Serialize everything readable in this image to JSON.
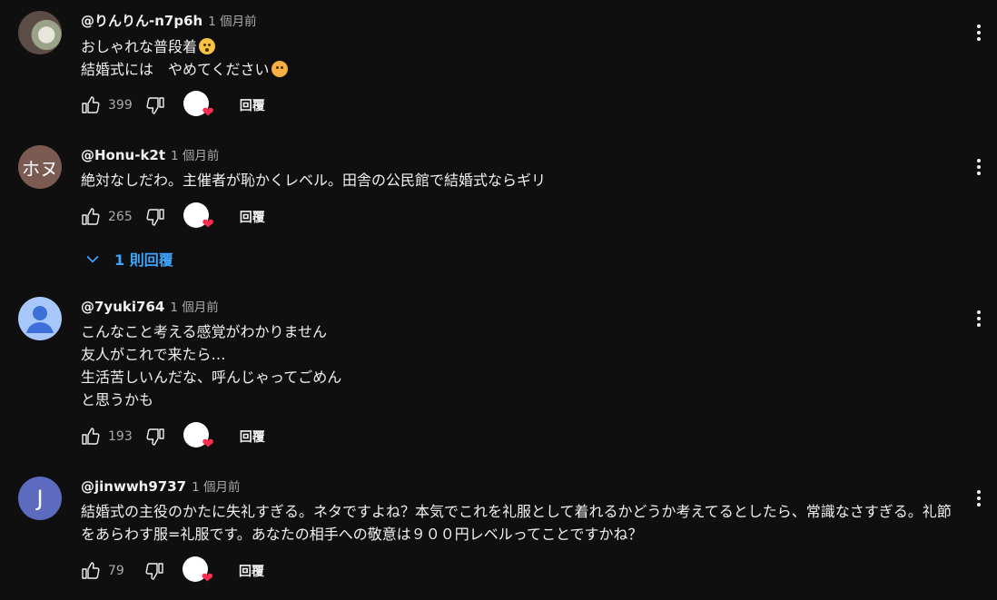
{
  "comments": [
    {
      "author": "@りんりん-n7p6h",
      "time": "1 個月前",
      "avatar_type": "photo",
      "lines": [
        "おしゃれな普段着",
        "結婚式には　やめてください"
      ],
      "likes": "399",
      "reply_label": "回覆"
    },
    {
      "author": "@Honu-k2t",
      "time": "1 個月前",
      "avatar_text": "ホヌ",
      "lines": [
        "絶対なしだわ。主催者が恥かくレベル。田舎の公民館で結婚式ならギリ"
      ],
      "likes": "265",
      "reply_label": "回覆",
      "replies_label": "1 則回覆"
    },
    {
      "author": "@7yuki764",
      "time": "1 個月前",
      "avatar_type": "default",
      "lines": [
        "こんなこと考える感覚がわかりません",
        "友人がこれで来たら…",
        "生活苦しいんだな、呼んじゃってごめん",
        "と思うかも"
      ],
      "likes": "193",
      "reply_label": "回覆"
    },
    {
      "author": "@jinwwh9737",
      "time": "1 個月前",
      "avatar_text": "J",
      "lines": [
        "結婚式の主役のかたに失礼すぎる。ネタですよね？本気でこれを礼服として着れるかどうか考えてるとしたら、常識なさすぎる。礼節をあらわす服=礼服です。あなたの相手への敬意は９００円レベルってことですかね？"
      ],
      "likes": "79",
      "reply_label": "回覆"
    }
  ],
  "icons": {
    "like": "thumb-up-icon",
    "dislike": "thumb-down-icon",
    "more": "more-vert-icon",
    "expand": "chevron-down-icon",
    "creator_heart": "creator-heart-icon"
  },
  "colors": {
    "background": "#0f0f0f",
    "text": "#f1f1f1",
    "secondary": "#aaaaaa",
    "link": "#3ea6ff",
    "heart": "#ff2d4f"
  }
}
